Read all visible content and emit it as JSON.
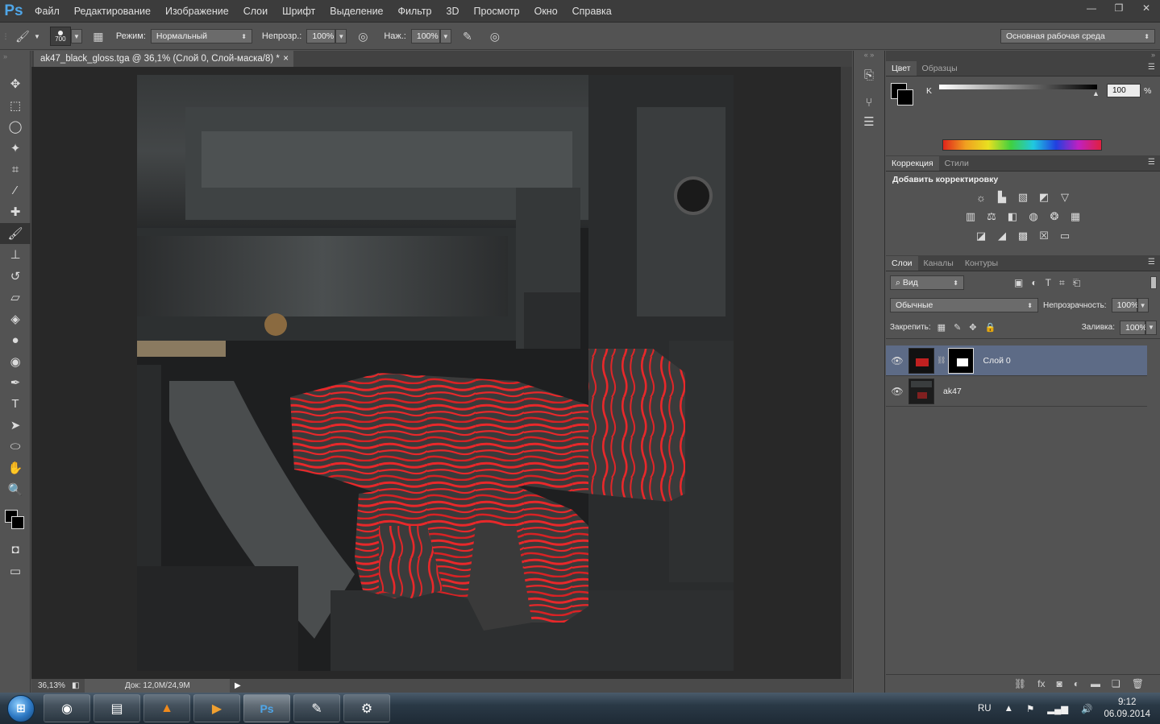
{
  "menubar": {
    "logo": "Ps",
    "items": [
      "Файл",
      "Редактирование",
      "Изображение",
      "Слои",
      "Шрифт",
      "Выделение",
      "Фильтр",
      "3D",
      "Просмотр",
      "Окно",
      "Справка"
    ]
  },
  "options": {
    "brush_size": "700",
    "mode_label": "Режим:",
    "mode_value": "Нормальный",
    "opacity_label": "Непрозр.:",
    "opacity_value": "100%",
    "pressure_label": "Наж.:",
    "pressure_value": "100%",
    "workspace": "Основная рабочая среда"
  },
  "document": {
    "tab_title": "ak47_black_gloss.tga @ 36,1% (Слой 0, Слой-маска/8) *",
    "close": "×",
    "zoom": "36,13%",
    "doc_info": "Док: 12,0M/24,9M"
  },
  "color_panel": {
    "tabs": [
      "Цвет",
      "Образцы"
    ],
    "channel_label": "K",
    "channel_value": "100",
    "percent": "%"
  },
  "adjust_panel": {
    "tabs": [
      "Коррекция",
      "Стили"
    ],
    "heading": "Добавить корректировку"
  },
  "layers_panel": {
    "tabs": [
      "Слои",
      "Каналы",
      "Контуры"
    ],
    "filter_value": "Вид",
    "blend_mode": "Обычные",
    "opacity_label": "Непрозрачность:",
    "opacity_value": "100%",
    "lock_label": "Закрепить:",
    "fill_label": "Заливка:",
    "fill_value": "100%",
    "layers": [
      {
        "name": "Слой 0",
        "selected": true
      },
      {
        "name": "ak47",
        "selected": false
      }
    ]
  },
  "taskbar": {
    "lang": "RU",
    "time": "9:12",
    "date": "06.09.2014"
  },
  "colors": {
    "accent_red": "#e8282a",
    "selected_layer": "#5d6b86"
  }
}
